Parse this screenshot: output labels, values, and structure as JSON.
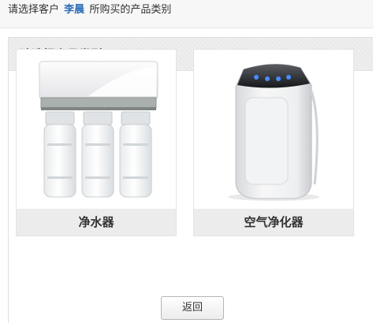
{
  "top_bar": {
    "prefix": "请选择客户",
    "customer_name": "李晨",
    "suffix": "所购买的产品类别"
  },
  "panel": {
    "title": "请选择产品类型"
  },
  "products": [
    {
      "label": "净水器",
      "icon": "water-purifier-image"
    },
    {
      "label": "空气净化器",
      "icon": "air-purifier-image"
    }
  ],
  "actions": {
    "back_label": "返回"
  }
}
